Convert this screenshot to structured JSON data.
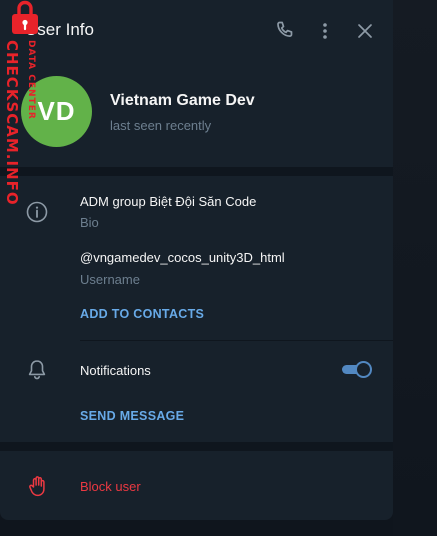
{
  "header": {
    "title": "User Info",
    "call_icon": "phone-icon",
    "more_icon": "more-vertical-icon",
    "close_icon": "close-icon"
  },
  "profile": {
    "avatar_initials": "VD",
    "avatar_color": "#62b249",
    "name": "Vietnam Game Dev",
    "status": "last seen recently"
  },
  "info": {
    "bio_value": "ADM group Biệt Đội Săn Code",
    "bio_label": "Bio",
    "username_value": "@vngamedev_cocos_unity3D_html",
    "username_label": "Username",
    "add_contacts": "ADD TO CONTACTS"
  },
  "notifications": {
    "label": "Notifications",
    "enabled": true,
    "send_message": "SEND MESSAGE"
  },
  "actions": {
    "block_user": "Block user"
  },
  "colors": {
    "panel_bg": "#17212b",
    "accent": "#68aae8",
    "danger": "#ec3942",
    "toggle": "#5288c1",
    "watermark": "#e8232a"
  },
  "watermark": {
    "main_text": "CHECKSCAM.INFO",
    "sub_text": "DATA CENTER"
  }
}
